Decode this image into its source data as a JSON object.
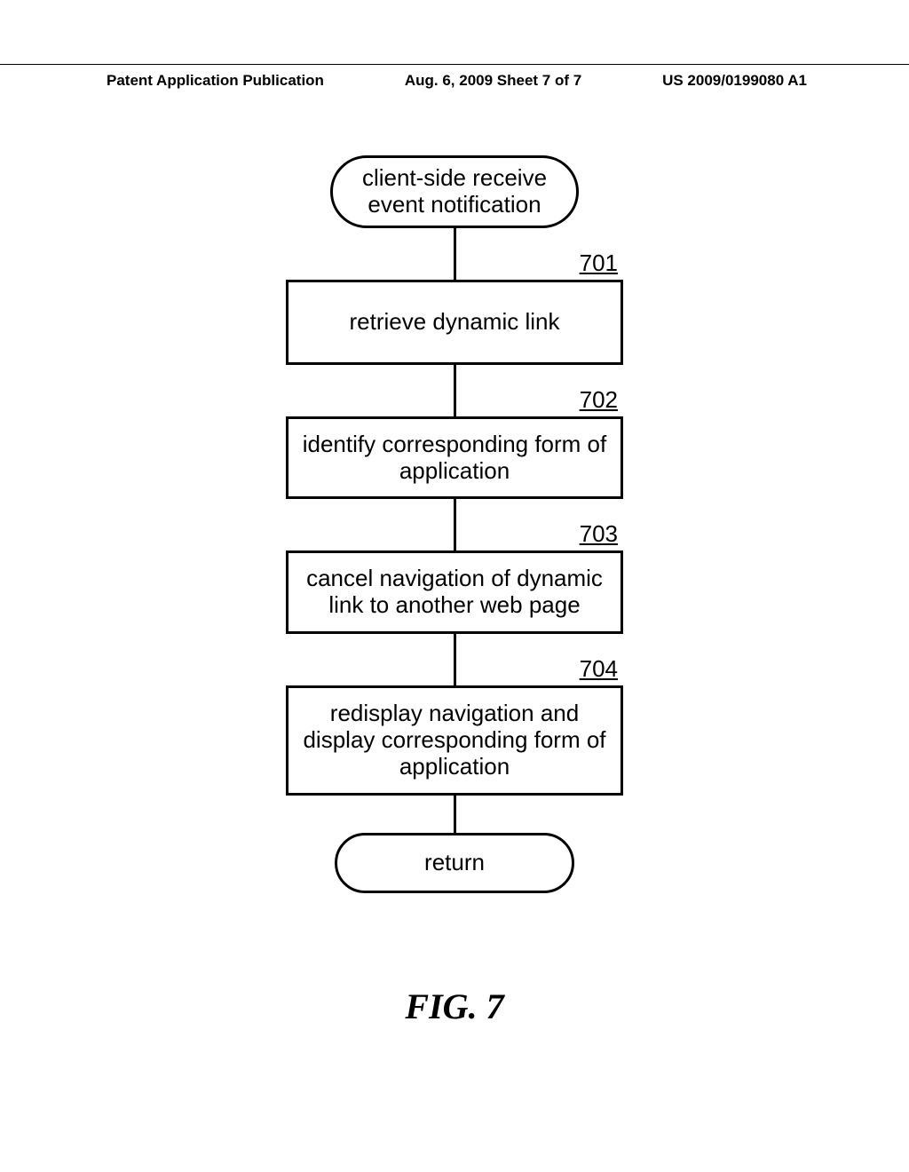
{
  "header": {
    "left": "Patent Application Publication",
    "center": "Aug. 6, 2009  Sheet 7 of 7",
    "right": "US 2009/0199080 A1"
  },
  "flowchart": {
    "start": "client-side receive event notification",
    "steps": [
      {
        "num": "701",
        "text": "retrieve dynamic link"
      },
      {
        "num": "702",
        "text": "identify corresponding form of application"
      },
      {
        "num": "703",
        "text": "cancel navigation of dynamic link to another web page"
      },
      {
        "num": "704",
        "text": "redisplay navigation and display corresponding form of application"
      }
    ],
    "end": "return"
  },
  "figure_label": "FIG. 7"
}
